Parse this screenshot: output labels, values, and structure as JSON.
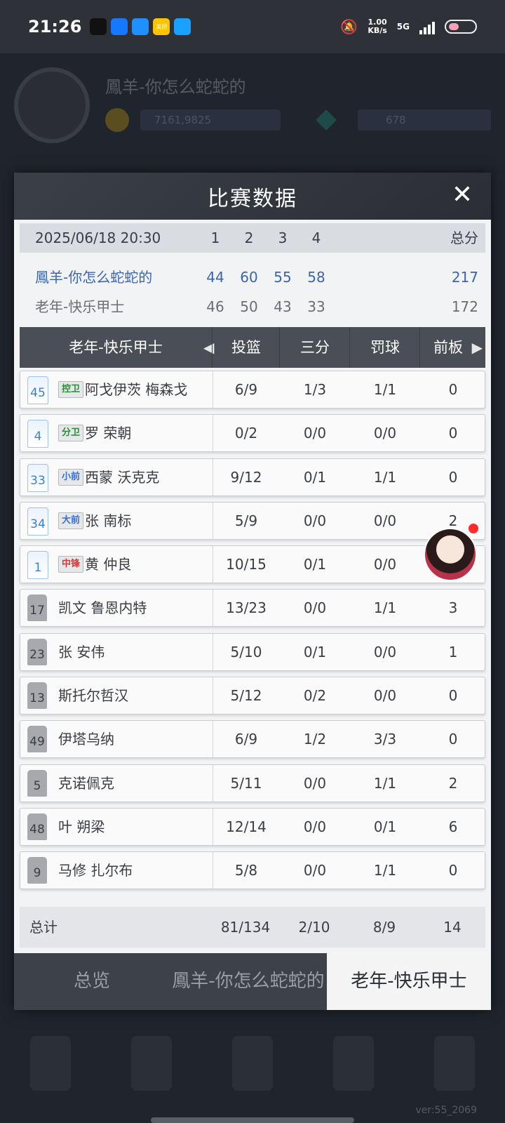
{
  "status_bar": {
    "time": "21:26",
    "apps": [
      {
        "name": "qq-icon",
        "color": "#111111",
        "text": ""
      },
      {
        "name": "browser-icon",
        "color": "#1677ff",
        "text": ""
      },
      {
        "name": "video-icon",
        "color": "#1e90ff",
        "text": ""
      },
      {
        "name": "meituan-icon",
        "color": "#ffc300",
        "text": "美团"
      },
      {
        "name": "wifi-app-icon",
        "color": "#1aa0ff",
        "text": ""
      }
    ],
    "speed": "1.00",
    "speed_unit": "KB/s",
    "network": "5G"
  },
  "background": {
    "username": "鳳羊-你怎么蛇蛇的",
    "coins": "7161,9825",
    "gems": "678",
    "version": "ver:55_2069"
  },
  "modal": {
    "title": "比赛数据",
    "close": "✕",
    "score_header": {
      "date": "2025/06/18 20:30",
      "q1": "1",
      "q2": "2",
      "q3": "3",
      "q4": "4",
      "total": "总分"
    },
    "teams": [
      {
        "name": "鳳羊-你怎么蛇蛇的",
        "q1": "44",
        "q2": "60",
        "q3": "55",
        "q4": "58",
        "total": "217"
      },
      {
        "name": "老年-快乐甲士",
        "q1": "46",
        "q2": "50",
        "q3": "43",
        "q4": "33",
        "total": "172"
      }
    ],
    "table": {
      "team": "老年-快乐甲士",
      "cols": {
        "fg": "投篮",
        "tp": "三分",
        "ft": "罚球",
        "oreb": "前板"
      }
    },
    "players": [
      {
        "num": "45",
        "pos": "控卫",
        "pos_color": "#2e8b3d",
        "name": "阿戈伊茨 梅森戈",
        "fg": "6/9",
        "tp": "1/3",
        "ft": "1/1",
        "oreb": "0",
        "starter": true
      },
      {
        "num": "4",
        "pos": "分卫",
        "pos_color": "#2e8b3d",
        "name": "罗 荣朝",
        "fg": "0/2",
        "tp": "0/0",
        "ft": "0/0",
        "oreb": "0",
        "starter": true
      },
      {
        "num": "33",
        "pos": "小前",
        "pos_color": "#3b6fc9",
        "name": "西蒙 沃克克",
        "fg": "9/12",
        "tp": "0/1",
        "ft": "1/1",
        "oreb": "0",
        "starter": true
      },
      {
        "num": "34",
        "pos": "大前",
        "pos_color": "#3b6fc9",
        "name": "张 南标",
        "fg": "5/9",
        "tp": "0/0",
        "ft": "0/0",
        "oreb": "2",
        "starter": true
      },
      {
        "num": "1",
        "pos": "中锋",
        "pos_color": "#d63a3a",
        "name": "黄 仲良",
        "fg": "10/15",
        "tp": "0/1",
        "ft": "0/0",
        "oreb": "",
        "starter": true
      },
      {
        "num": "17",
        "pos": "",
        "pos_color": "",
        "name": "凯文 鲁恩内特",
        "fg": "13/23",
        "tp": "0/0",
        "ft": "1/1",
        "oreb": "3",
        "starter": false
      },
      {
        "num": "23",
        "pos": "",
        "pos_color": "",
        "name": "张 安伟",
        "fg": "5/10",
        "tp": "0/1",
        "ft": "0/0",
        "oreb": "1",
        "starter": false
      },
      {
        "num": "13",
        "pos": "",
        "pos_color": "",
        "name": "斯托尔哲汉",
        "fg": "5/12",
        "tp": "0/2",
        "ft": "0/0",
        "oreb": "0",
        "starter": false
      },
      {
        "num": "49",
        "pos": "",
        "pos_color": "",
        "name": "伊塔乌纳",
        "fg": "6/9",
        "tp": "1/2",
        "ft": "3/3",
        "oreb": "0",
        "starter": false
      },
      {
        "num": "5",
        "pos": "",
        "pos_color": "",
        "name": "克诺佩克",
        "fg": "5/11",
        "tp": "0/0",
        "ft": "1/1",
        "oreb": "2",
        "starter": false
      },
      {
        "num": "48",
        "pos": "",
        "pos_color": "",
        "name": "叶 朔梁",
        "fg": "12/14",
        "tp": "0/0",
        "ft": "0/1",
        "oreb": "6",
        "starter": false
      },
      {
        "num": "9",
        "pos": "",
        "pos_color": "",
        "name": "马修 扎尔布",
        "fg": "5/8",
        "tp": "0/0",
        "ft": "1/1",
        "oreb": "0",
        "starter": false
      }
    ],
    "total": {
      "label": "总计",
      "fg": "81/134",
      "tp": "2/10",
      "ft": "8/9",
      "oreb": "14"
    },
    "tabs": [
      "总览",
      "鳳羊-你怎么蛇蛇的",
      "老年-快乐甲士"
    ],
    "active_tab": 2
  }
}
